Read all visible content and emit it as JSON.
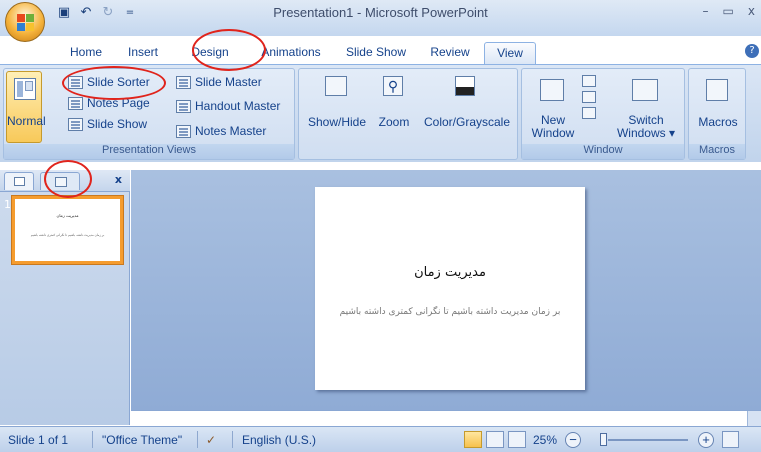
{
  "titlebar": {
    "title": "Presentation1 - Microsoft PowerPoint",
    "qat": [
      "save-icon",
      "undo-icon",
      "redo-icon",
      "qat-dropdown-icon"
    ],
    "controls": {
      "minimize": "–",
      "maximize": "▭",
      "close": "x"
    }
  },
  "tabs": [
    "Home",
    "Insert",
    "Design",
    "Animations",
    "Slide Show",
    "Review",
    "View"
  ],
  "active_tab": "View",
  "help_icon": "?",
  "ribbon": {
    "presentation_views": {
      "label": "Presentation Views",
      "normal": "Normal",
      "slide_sorter": "Slide Sorter",
      "notes_page": "Notes Page",
      "slide_show": "Slide Show",
      "slide_master": "Slide Master",
      "handout_master": "Handout Master",
      "notes_master": "Notes Master"
    },
    "show_hide": "Show/Hide",
    "zoom": "Zoom",
    "color_grayscale": "Color/Grayscale",
    "window": {
      "label": "Window",
      "new_window_1": "New",
      "new_window_2": "Window",
      "switch_1": "Switch",
      "switch_2": "Windows ▾"
    },
    "macros": {
      "label": "Macros",
      "button": "Macros"
    }
  },
  "slide": {
    "number": "1",
    "title": "مدیریت زمان",
    "body": "بر زمان مدیریت داشته باشیم تا نگرانی کمتری داشته باشیم"
  },
  "status": {
    "slide": "Slide 1 of 1",
    "theme": "\"Office Theme\"",
    "language": "English (U.S.)",
    "zoom": "25%",
    "minus": "−",
    "plus": "+"
  },
  "colors": {
    "annotation": "#e0241c",
    "thumb_border": "#f59c2e"
  }
}
